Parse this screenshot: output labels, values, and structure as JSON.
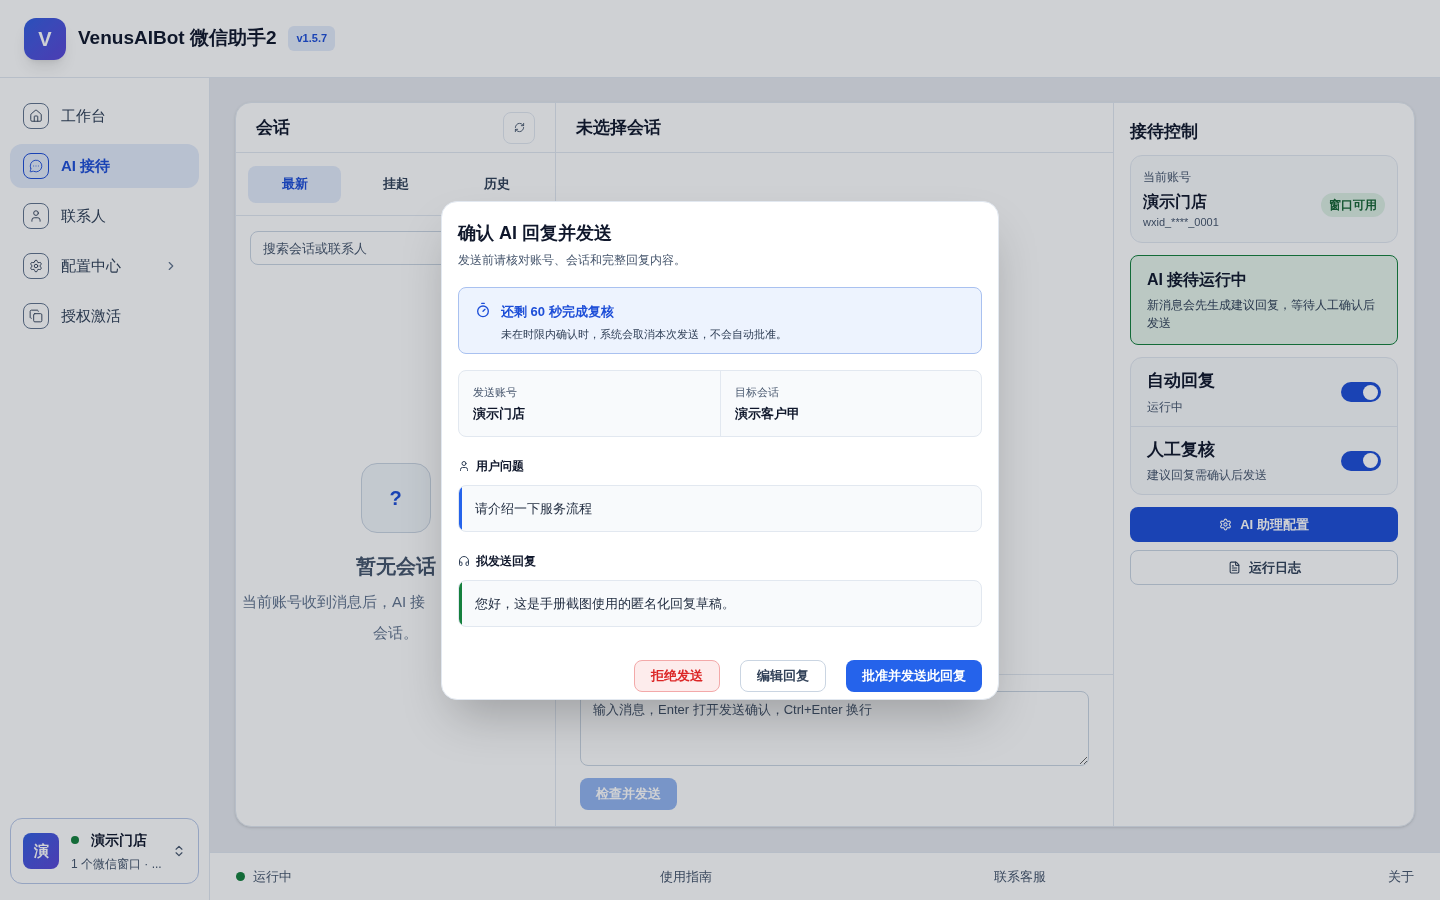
{
  "app": {
    "logo": "V",
    "title": "VenusAIBot 微信助手2",
    "version": "v1.5.7"
  },
  "sidebar": {
    "items": [
      {
        "label": "工作台",
        "selected": false,
        "has_submenu": false
      },
      {
        "label": "AI 接待",
        "selected": true,
        "has_submenu": false
      },
      {
        "label": "联系人",
        "selected": false,
        "has_submenu": false
      },
      {
        "label": "配置中心",
        "selected": false,
        "has_submenu": true
      },
      {
        "label": "授权激活",
        "selected": false,
        "has_submenu": false
      }
    ],
    "account": {
      "avatar": "演",
      "name": "演示门店",
      "online": true,
      "detail": "1 个微信窗口 · ..."
    }
  },
  "conversations": {
    "title": "会话",
    "tabs": [
      {
        "label": "最新",
        "selected": true
      },
      {
        "label": "挂起",
        "selected": false
      },
      {
        "label": "历史",
        "selected": false
      }
    ],
    "search": {
      "placeholder": "搜索会话或联系人"
    },
    "empty": {
      "icon": "?",
      "title": "暂无会话",
      "lines": [
        "当前账号收到消息后，AI 接",
        "会话。"
      ]
    }
  },
  "chat": {
    "title": "未选择会话",
    "input": {
      "placeholder": "输入消息，Enter 打开发送确认，Ctrl+Enter 换行"
    },
    "send_button": {
      "label": "检查并发送",
      "disabled": true
    }
  },
  "control": {
    "title": "接待控制",
    "account": {
      "label": "当前账号",
      "name": "演示门店",
      "wxid": "wxid_****_0001",
      "badge": "窗口可用"
    },
    "status": {
      "title": "AI 接待运行中",
      "text": "新消息会先生成建议回复，等待人工确认后发送"
    },
    "toggles": [
      {
        "title": "自动回复",
        "subtitle": "运行中",
        "on": true
      },
      {
        "title": "人工复核",
        "subtitle": "建议回复需确认后发送",
        "on": true
      }
    ],
    "buttons": [
      {
        "label": "AI 助理配置",
        "kind": "primary"
      },
      {
        "label": "运行日志",
        "kind": "outline"
      }
    ]
  },
  "status_bar": {
    "running": true,
    "items": [
      "运行中",
      "使用指南",
      "联系客服",
      "关于"
    ]
  },
  "dialog": {
    "title": "确认 AI 回复并发送",
    "subtitle": "发送前请核对账号、会话和完整回复内容。",
    "notice": {
      "title": "还剩 60 秒完成复核",
      "text": "未在时限内确认时，系统会取消本次发送，不会自动批准。"
    },
    "fields": [
      {
        "label": "发送账号",
        "value": "演示门店"
      },
      {
        "label": "目标会话",
        "value": "演示客户甲"
      }
    ],
    "sections": [
      {
        "heading": "用户问题",
        "text": "请介绍一下服务流程",
        "color": "#2563eb"
      },
      {
        "heading": "拟发送回复",
        "text": "您好，这是手册截图使用的匿名化回复草稿。",
        "color": "#15803d"
      }
    ],
    "buttons": [
      {
        "label": "拒绝发送",
        "kind": "danger"
      },
      {
        "label": "编辑回复",
        "kind": "outline"
      },
      {
        "label": "批准并发送此回复",
        "kind": "primary"
      }
    ]
  }
}
